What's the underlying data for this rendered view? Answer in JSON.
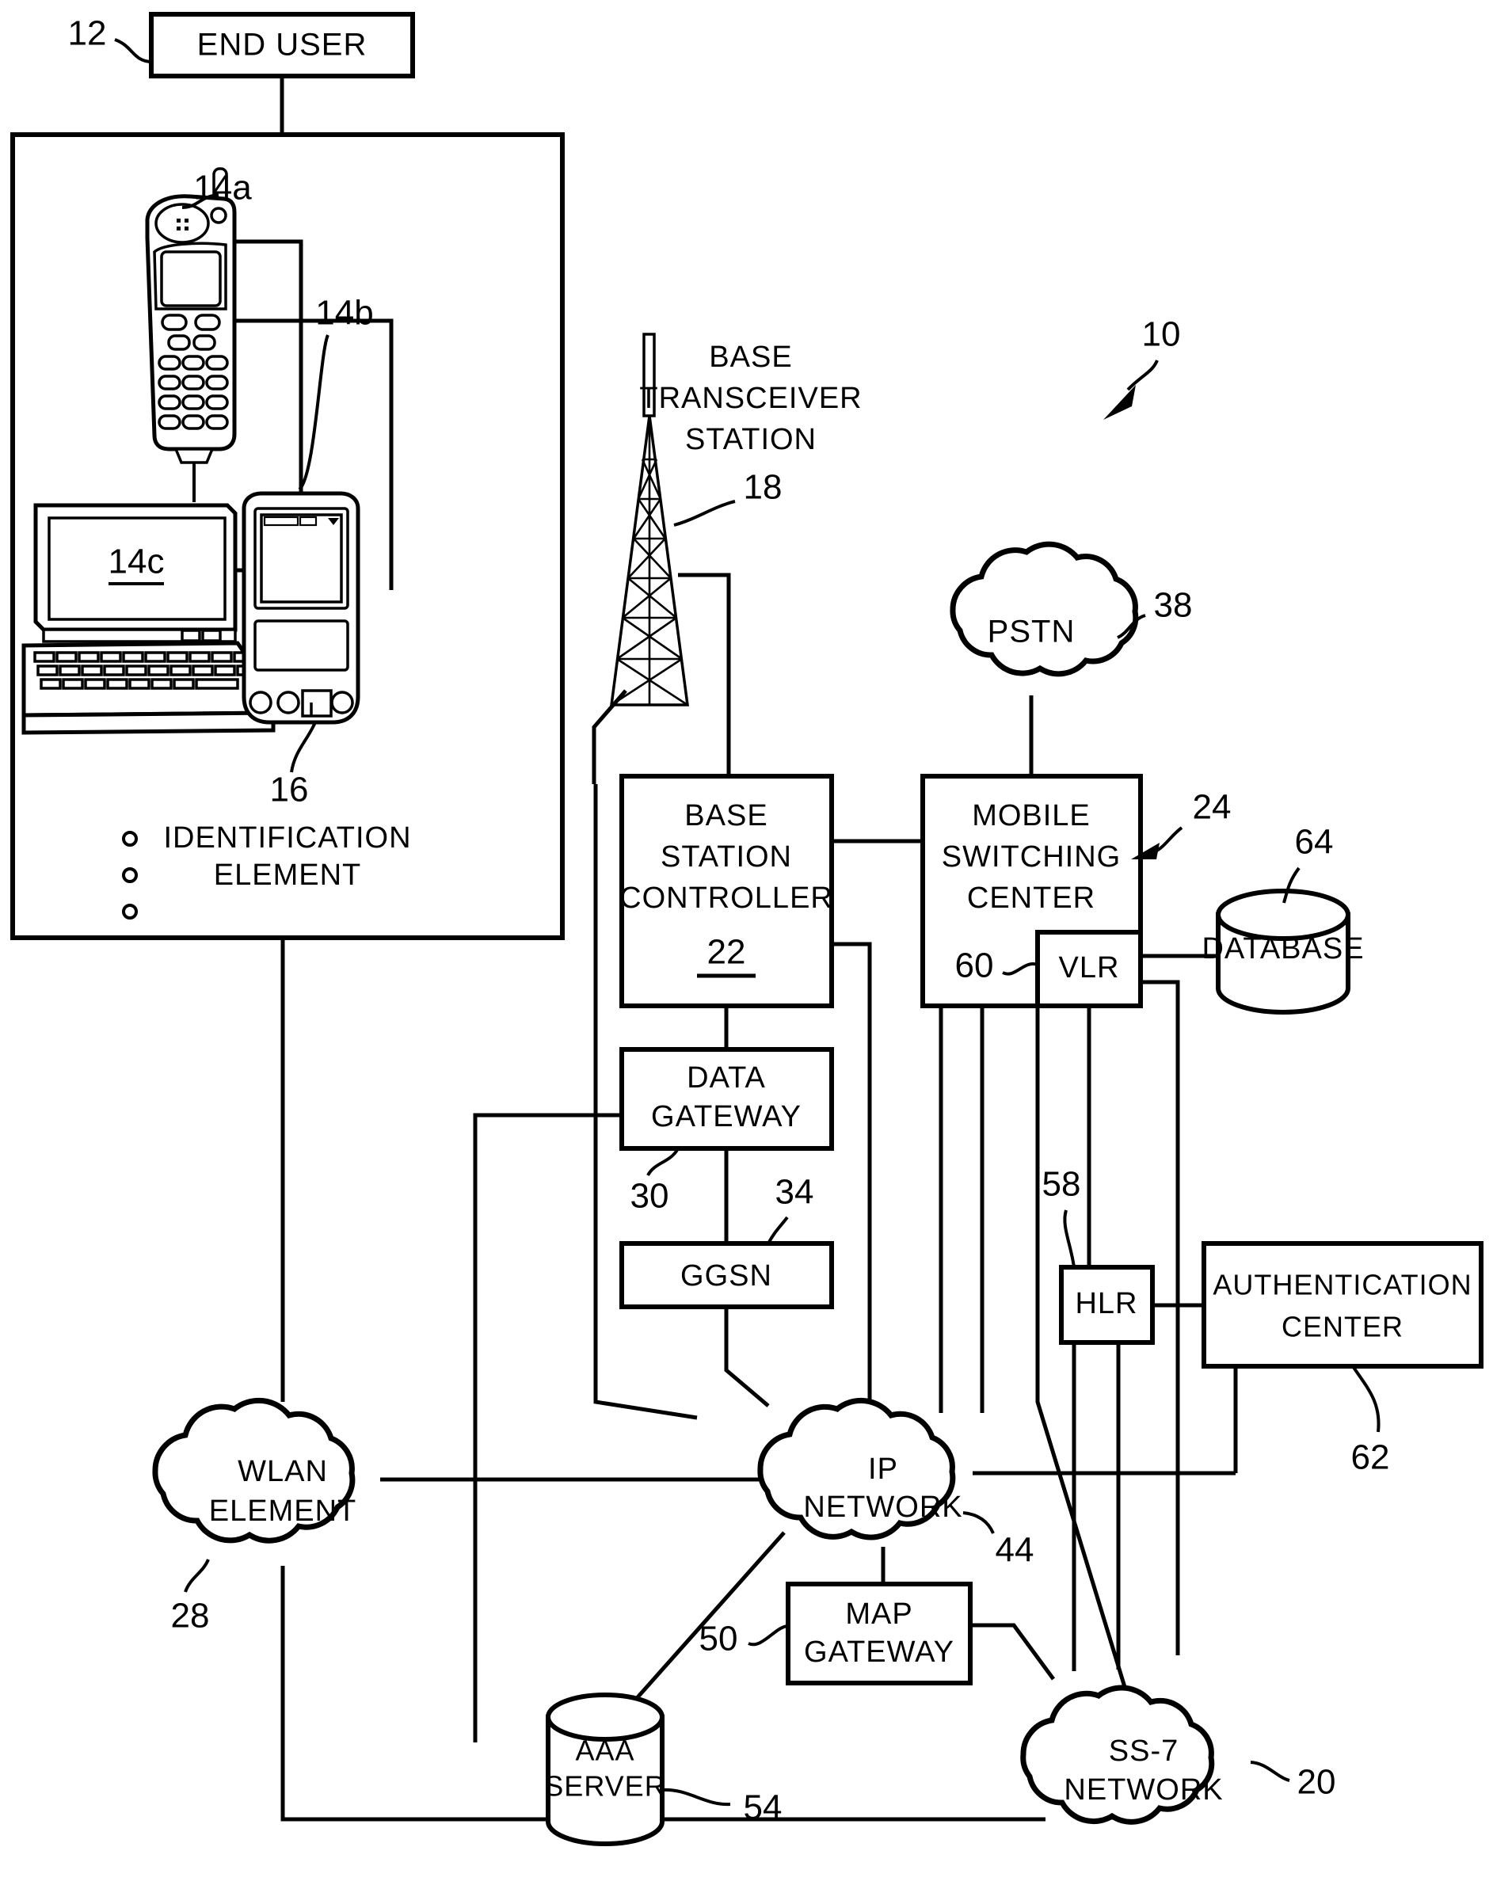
{
  "figure": {
    "reference_numeral": "10",
    "boxes": {
      "end_user": "END  USER",
      "base_station_controller": [
        "BASE",
        "STATION",
        "CONTROLLER"
      ],
      "base_station_controller_num": "22",
      "mobile_switching_center": [
        "MOBILE",
        "SWITCHING",
        "CENTER"
      ],
      "vlr": "VLR",
      "data_gateway": [
        "DATA",
        "GATEWAY"
      ],
      "ggsn": "GGSN",
      "hlr": "HLR",
      "authentication_center": [
        "AUTHENTICATION",
        "CENTER"
      ],
      "map_gateway": [
        "MAP",
        "GATEWAY"
      ],
      "database": "DATABASE",
      "aaa_server": [
        "AAA",
        "SERVER"
      ]
    },
    "clouds": {
      "pstn": [
        "PSTN"
      ],
      "wlan_element": [
        "WLAN",
        "ELEMENT"
      ],
      "ip_network": [
        "IP",
        "NETWORK"
      ],
      "ss7_network": [
        "SS-7",
        "NETWORK"
      ]
    },
    "free_labels": {
      "base_transceiver_station": [
        "BASE",
        "TRANSCEIVER",
        "STATION"
      ],
      "identification_element": [
        "IDENTIFICATION",
        "ELEMENT"
      ]
    },
    "numerals": {
      "end_user": "12",
      "mobile_phone": "14a",
      "pda": "14b",
      "laptop": "14c",
      "identification_element": "16",
      "base_transceiver_station": "18",
      "ss7_network": "20",
      "base_station_controller": "22",
      "mobile_switching_center": "24",
      "wlan_element": "28",
      "data_gateway": "30",
      "ggsn": "34",
      "pstn": "38",
      "ip_network": "44",
      "map_gateway": "50",
      "aaa_server": "54",
      "hlr": "58",
      "vlr": "60",
      "authentication_center": "62",
      "database": "64",
      "system": "10"
    },
    "colors": {
      "ink": "#000000",
      "paper": "#ffffff"
    }
  }
}
